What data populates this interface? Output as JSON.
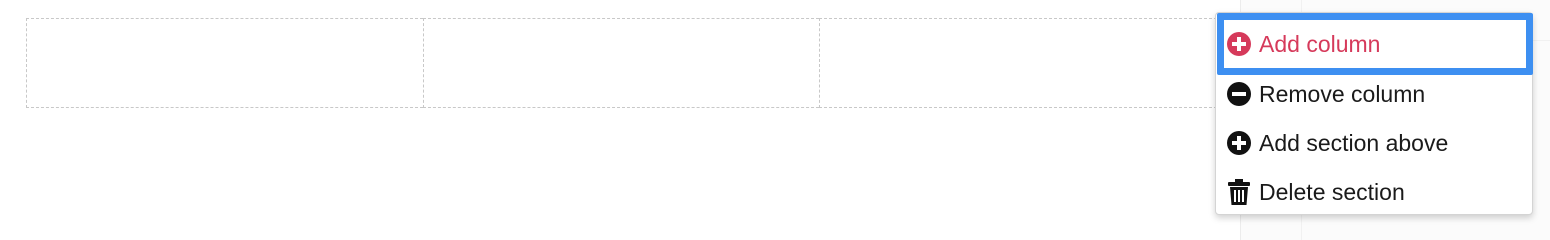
{
  "colors": {
    "accent": "#d63a5b",
    "focus_outline": "#3d8ff1",
    "text": "#1a1a1a",
    "dashed_border": "#c8c8c8"
  },
  "section": {
    "columns": 3
  },
  "context_menu": {
    "items": [
      {
        "label": "Add column",
        "icon": "plus-circle-icon",
        "active": true
      },
      {
        "label": "Remove column",
        "icon": "minus-circle-icon",
        "active": false
      },
      {
        "label": "Add section above",
        "icon": "plus-circle-icon",
        "active": false
      },
      {
        "label": "Delete section",
        "icon": "trash-icon",
        "active": false
      }
    ]
  }
}
